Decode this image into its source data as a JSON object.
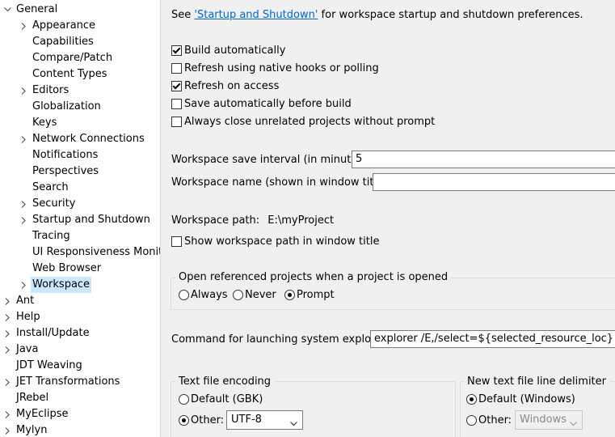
{
  "tree": {
    "items": [
      {
        "label": "General",
        "arrow": "expanded",
        "level": 0
      },
      {
        "label": "Appearance",
        "arrow": "collapsed",
        "level": 1
      },
      {
        "label": "Capabilities",
        "arrow": "none",
        "level": 1
      },
      {
        "label": "Compare/Patch",
        "arrow": "none",
        "level": 1
      },
      {
        "label": "Content Types",
        "arrow": "none",
        "level": 1
      },
      {
        "label": "Editors",
        "arrow": "collapsed",
        "level": 1
      },
      {
        "label": "Globalization",
        "arrow": "none",
        "level": 1
      },
      {
        "label": "Keys",
        "arrow": "none",
        "level": 1
      },
      {
        "label": "Network Connections",
        "arrow": "collapsed",
        "level": 1
      },
      {
        "label": "Notifications",
        "arrow": "none",
        "level": 1
      },
      {
        "label": "Perspectives",
        "arrow": "none",
        "level": 1
      },
      {
        "label": "Search",
        "arrow": "none",
        "level": 1
      },
      {
        "label": "Security",
        "arrow": "collapsed",
        "level": 1
      },
      {
        "label": "Startup and Shutdown",
        "arrow": "collapsed",
        "level": 1
      },
      {
        "label": "Tracing",
        "arrow": "none",
        "level": 1
      },
      {
        "label": "UI Responsiveness Monito",
        "arrow": "none",
        "level": 1
      },
      {
        "label": "Web Browser",
        "arrow": "none",
        "level": 1
      },
      {
        "label": "Workspace",
        "arrow": "collapsed",
        "level": 1,
        "selected": true
      },
      {
        "label": "Ant",
        "arrow": "collapsed",
        "level": 0
      },
      {
        "label": "Help",
        "arrow": "collapsed",
        "level": 0
      },
      {
        "label": "Install/Update",
        "arrow": "collapsed",
        "level": 0
      },
      {
        "label": "Java",
        "arrow": "collapsed",
        "level": 0
      },
      {
        "label": "JDT Weaving",
        "arrow": "none",
        "level": 0
      },
      {
        "label": "JET Transformations",
        "arrow": "collapsed",
        "level": 0
      },
      {
        "label": "JRebel",
        "arrow": "none",
        "level": 0
      },
      {
        "label": "MyEclipse",
        "arrow": "collapsed",
        "level": 0
      },
      {
        "label": "Mylyn",
        "arrow": "collapsed",
        "level": 0
      }
    ]
  },
  "workspace": {
    "see_prefix": "See ",
    "see_link": "'Startup and Shutdown'",
    "see_suffix": " for workspace startup and shutdown preferences.",
    "checkboxes": {
      "build_automatically": {
        "label": "Build automatically",
        "checked": true
      },
      "refresh_native": {
        "label": "Refresh using native hooks or polling",
        "checked": false
      },
      "refresh_on_access": {
        "label": "Refresh on access",
        "checked": true
      },
      "save_before_build": {
        "label": "Save automatically before build",
        "checked": false
      },
      "close_unrelated": {
        "label": "Always close unrelated projects without prompt",
        "checked": false
      }
    },
    "save_interval_label": "Workspace save interval (in minutes):",
    "save_interval_value": "5",
    "workspace_name_label": "Workspace name (shown in window title):",
    "workspace_name_value": "",
    "workspace_path_label": "Workspace path:",
    "workspace_path_value": "E:\\myProject",
    "show_path_label": "Show workspace path in window title",
    "show_path_checked": false,
    "open_referenced": {
      "title": "Open referenced projects when a project is opened",
      "options": [
        "Always",
        "Never",
        "Prompt"
      ],
      "selected": "Prompt"
    },
    "explorer_label": "Command for launching system explorer:",
    "explorer_value": "explorer /E,/select=${selected_resource_loc}",
    "encoding": {
      "title": "Text file encoding",
      "default_label": "Default (GBK)",
      "other_label": "Other:",
      "selected": "Other",
      "other_value": "UTF-8"
    },
    "delimiter": {
      "title": "New text file line delimiter",
      "default_label": "Default (Windows)",
      "other_label": "Other:",
      "selected": "Default",
      "other_value": "Windows"
    }
  }
}
